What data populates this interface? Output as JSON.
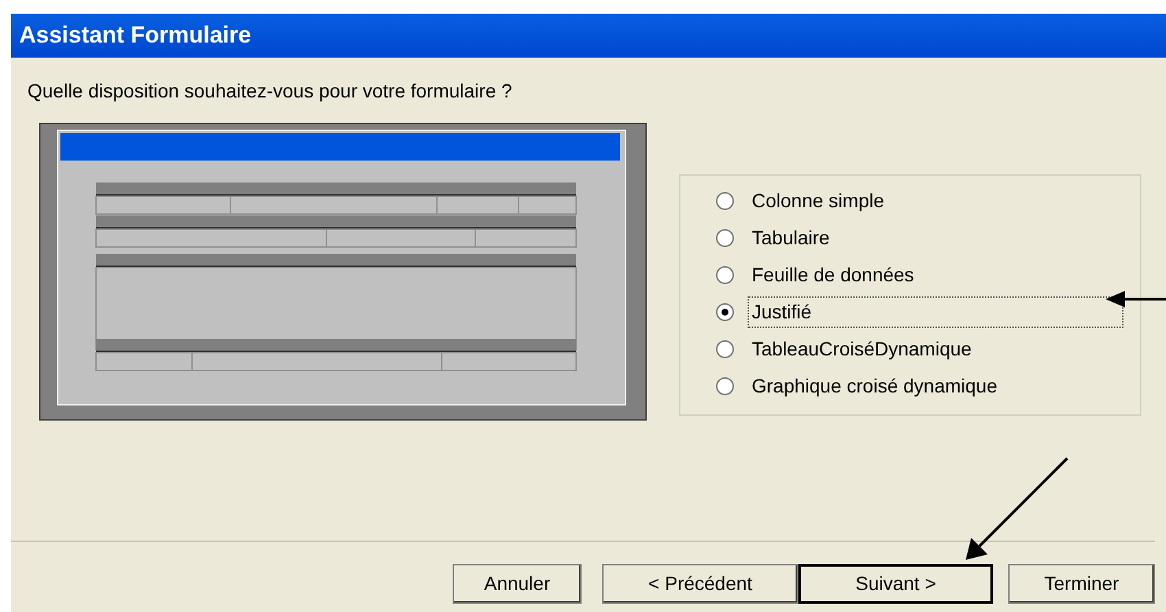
{
  "window": {
    "title": "Assistant Formulaire"
  },
  "question": "Quelle disposition souhaitez-vous pour votre formulaire ?",
  "layouts": [
    {
      "label": "Colonne simple",
      "selected": false
    },
    {
      "label": "Tabulaire",
      "selected": false
    },
    {
      "label": "Feuille de données",
      "selected": false
    },
    {
      "label": "Justifié",
      "selected": true
    },
    {
      "label": "TableauCroiséDynamique",
      "selected": false
    },
    {
      "label": "Graphique croisé dynamique",
      "selected": false
    }
  ],
  "buttons": [
    {
      "label": "Annuler",
      "default": false
    },
    {
      "label": "< Précédent",
      "default": false
    },
    {
      "label": "Suivant >",
      "default": true
    },
    {
      "label": "Terminer",
      "default": false
    }
  ]
}
